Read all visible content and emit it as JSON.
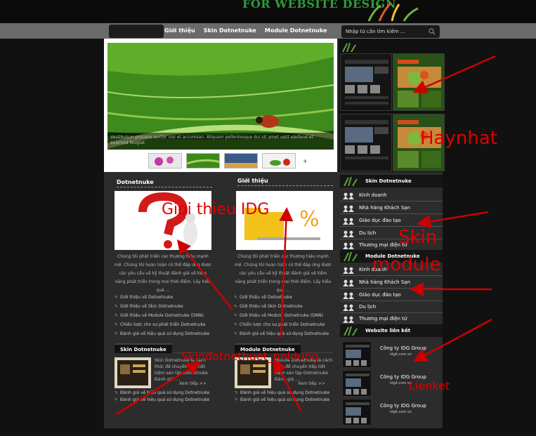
{
  "header": {
    "logo_text": "FOR WEBSITE DESIGN"
  },
  "nav": {
    "items": [
      {
        "label": "Giới thiệu"
      },
      {
        "label": "Skin Dotnetnuke"
      },
      {
        "label": "Module Dotnetnuke"
      }
    ]
  },
  "search": {
    "placeholder": "Nhập từ cần tìm kiếm ..."
  },
  "slider": {
    "caption": "Vestibulum posuere auctor nisi et accumsan. Aliquam pellentesque dui sit amet velit eleifend et euismod feugiat.",
    "thumbs_more": "+"
  },
  "col1": {
    "title": "Dotnetnuke",
    "text": "Chúng tôi phát triển các thương hiệu mạnh mẽ. Chúng tôi hoàn toàn có thể đáp ứng được các yêu cầu về kỹ thuật đánh giá về tiềm năng phát triển trong mọi thời điểm. Lấy hiểu quả ...",
    "links": [
      "Giới thiệu về Dotnetnuke",
      "Giới thiệu về Skin Dotnetnuke",
      "Giới thiệu về Module Dotnetnuke (DNN)",
      "Chiến lược cho sự phát triển Dotnetnuke",
      "Đánh giá về hiệu quả sử dụng Dotnetnuke"
    ]
  },
  "col2": {
    "title": "Giới thiệu",
    "text": "Chúng tôi phát triển các thương hiệu mạnh mẽ. Chúng tôi hoàn toàn có thể đáp ứng được các yêu cầu về kỹ thuật đánh giá về tiềm năng phát triển trong mọi thời điểm. Lấy hiểu quả ...",
    "links": [
      "Giới thiệu về Dotnetnuke",
      "Giới thiệu về Skin Dotnetnuke",
      "Giới thiệu về Module Dotnetnuke (DNN)",
      "Chiến lược cho sự phát triển Dotnetnuke",
      "Đánh giá về hiệu quả sử dụng Dotnetnuke"
    ]
  },
  "skin_block": {
    "title": "Skin Dotnetnuke",
    "text": "Skin Dotnetnuke là cách thức để chuyển tiếp tiết kiệm sản tập Dotnetnuke Đánh giá ....",
    "more": "Xem tiếp >>",
    "links": [
      "Đánh giá về hiệu quả sử dụng Dotnetnuke",
      "Đánh giá về hiệu quả sử dụng Dotnetnuke"
    ]
  },
  "module_block": {
    "title": "Module Dotnetnuke",
    "text": "Module Dotnetnuke là cách thức để chuyển tiếp tiết kiệm sản tập Dotnetnuke Đánh giá ....",
    "more": "Xem tiếp >>",
    "links": [
      "Đánh giá về hiệu quả sử dụng Dotnetnuke",
      "Đánh giá về hiệu quả sử dụng Dotnetnuke"
    ]
  },
  "sidebar": {
    "skin_title": "Skin Dotnetnuke",
    "skin_items": [
      "Kinh doanh",
      "Nhà hàng   Khách Sạn",
      "Giáo dục đào tạo",
      "Du lịch",
      "Thương mại điện tử"
    ],
    "module_title": "Module Dotnetnuke",
    "module_items": [
      "Kinh doanh",
      "Nhà hàng   Khách Sạn",
      "Giáo dục đào tạo",
      "Du lịch",
      "Thương mại điện tử"
    ],
    "links_title": "Website liên kết",
    "partners": [
      {
        "name": "Công ty IDG Group",
        "url": "idgit.com.vn"
      },
      {
        "name": "Công ty IDG Group",
        "url": "idgit.com.vn"
      },
      {
        "name": "Công ty IDG Group",
        "url": "idgit.com.vn"
      }
    ]
  },
  "annotations": {
    "haynhat": "Haynhat",
    "gioi_thieu": "Gioi thieu IDG",
    "skin_module_1": "Skin",
    "skin_module_2": "module",
    "skin_noidung": "Skindotnethuet_noidung",
    "lienket": "Lienket"
  },
  "colors": {
    "annotation": "#cc0000",
    "logo": "#2f9a3a"
  }
}
